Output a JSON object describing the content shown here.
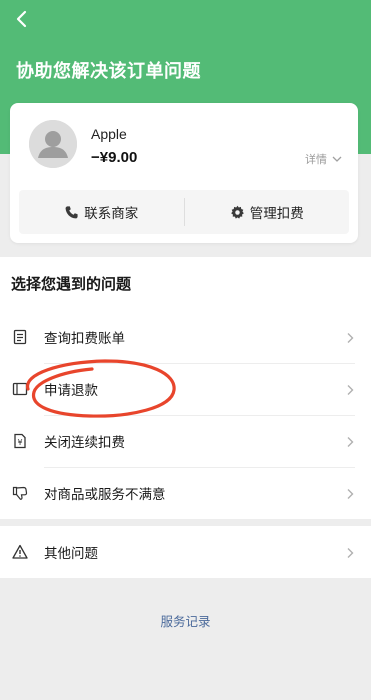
{
  "header": {
    "title": "协助您解决该订单问题"
  },
  "order": {
    "merchant": "Apple",
    "amount": "−¥9.00",
    "detail_label": "详情"
  },
  "actions": {
    "contact_label": "联系商家",
    "manage_label": "管理扣费"
  },
  "issues": {
    "title": "选择您遇到的问题",
    "items": [
      {
        "label": "查询扣费账单",
        "icon": "bill-icon"
      },
      {
        "label": "申请退款",
        "icon": "refund-icon"
      },
      {
        "label": "关闭连续扣费",
        "icon": "cancel-subscription-icon"
      },
      {
        "label": "对商品或服务不满意",
        "icon": "thumbs-down-icon"
      }
    ],
    "other_label": "其他问题"
  },
  "footer": {
    "service_record": "服务记录"
  },
  "colors": {
    "brand_green": "#53bb76",
    "link_blue": "#4b6a9b",
    "annotation_red": "#e8452c"
  }
}
